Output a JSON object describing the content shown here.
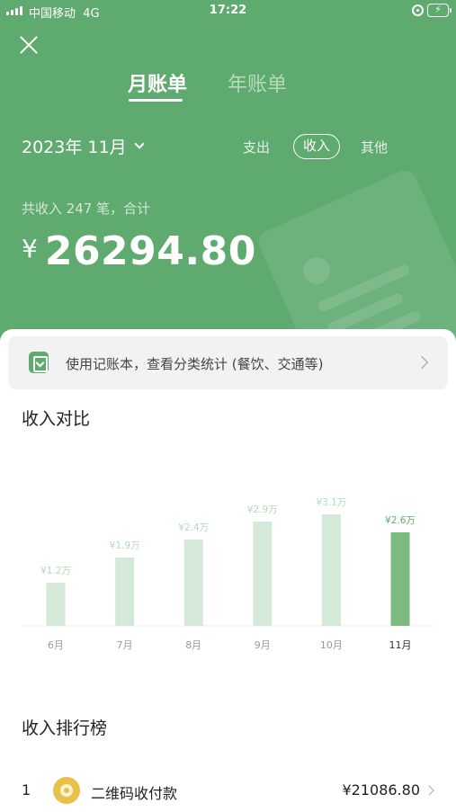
{
  "status_bar": {
    "carrier": "中国移动",
    "network": "4G",
    "time": "17:22"
  },
  "tabs": {
    "month": "月账单",
    "year": "年账单"
  },
  "period": {
    "label": "2023年 11月"
  },
  "filters": {
    "expense": "支出",
    "income": "收入",
    "other": "其他"
  },
  "summary": {
    "text": "共收入 247 笔，合计",
    "currency": "¥",
    "total": "26294.80"
  },
  "banner": {
    "text": "使用记账本，查看分类统计 (餐饮、交通等)"
  },
  "sections": {
    "compare_title": "收入对比",
    "ranking_title": "收入排行榜"
  },
  "colors": {
    "brand_green": "#5faa6f",
    "bar_light": "#d5e9d8",
    "bar_active": "#7cba82",
    "label_light": "#b8d8bc",
    "label_active": "#5faa6f"
  },
  "chart_data": {
    "type": "bar",
    "categories": [
      "6月",
      "7月",
      "8月",
      "9月",
      "10月",
      "11月"
    ],
    "values": [
      1.2,
      1.9,
      2.4,
      2.9,
      3.1,
      2.6
    ],
    "value_labels": [
      "¥1.2万",
      "¥1.9万",
      "¥2.4万",
      "¥2.9万",
      "¥3.1万",
      "¥2.6万"
    ],
    "highlight_index": 5,
    "ylim": [
      0,
      4.4
    ],
    "grid": false
  },
  "ranking": [
    {
      "rank": "1",
      "icon": "qr-payment-icon",
      "name": "二维码收付款",
      "amount": "¥21086.80"
    }
  ]
}
